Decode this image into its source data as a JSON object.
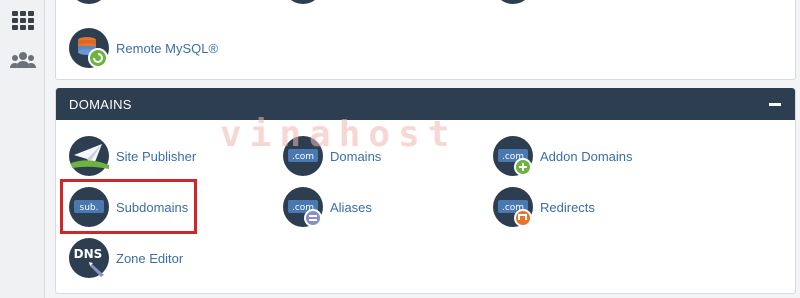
{
  "rail": {
    "icons": [
      "apps-grid-icon",
      "users-icon"
    ]
  },
  "top_panel": {
    "items": [
      {
        "label": "Remote MySQL®",
        "icon": "remote-mysql-icon"
      }
    ]
  },
  "domains": {
    "title": "DOMAINS",
    "items": [
      {
        "label": "Site Publisher",
        "icon": "site-publisher-icon"
      },
      {
        "label": "Domains",
        "icon": "domains-icon",
        "badge": ".com"
      },
      {
        "label": "Addon Domains",
        "icon": "addon-domains-icon",
        "badge": ".com"
      },
      {
        "label": "Subdomains",
        "icon": "subdomains-icon",
        "badge": "sub."
      },
      {
        "label": "Aliases",
        "icon": "aliases-icon",
        "badge": ".com"
      },
      {
        "label": "Redirects",
        "icon": "redirects-icon",
        "badge": ".com"
      },
      {
        "label": "Zone Editor",
        "icon": "zone-editor-icon",
        "badge": "DNS"
      }
    ]
  },
  "watermark": "vinahost",
  "colors": {
    "header_bg": "#2c3e50",
    "link": "#3b6ea3",
    "highlight": "#d22526",
    "icon_bg": "#2c3e50",
    "plus_green": "#6db33f",
    "orange": "#e8742a",
    "equals_purple": "#8a8fc8"
  }
}
